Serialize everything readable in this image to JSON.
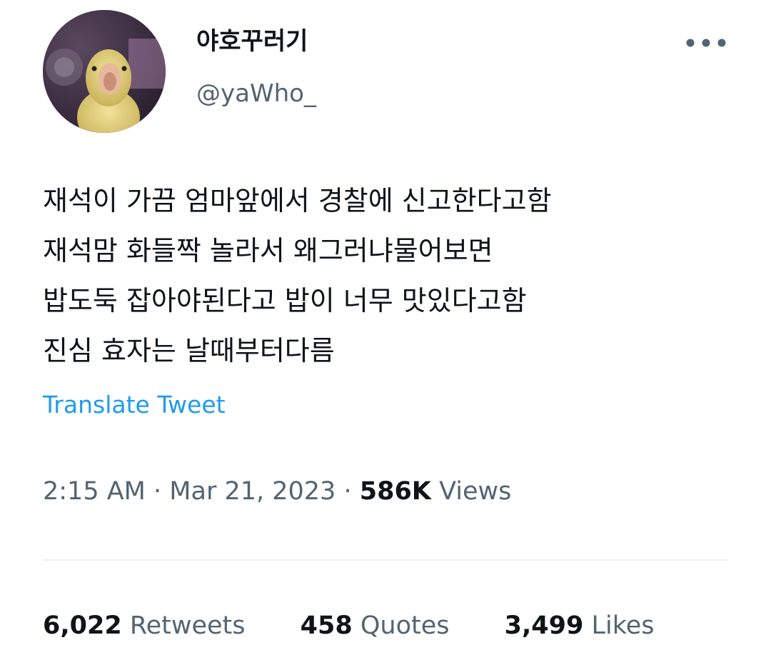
{
  "author": {
    "display_name": "야호꾸러기",
    "handle": "@yaWho_"
  },
  "tweet": {
    "lines": [
      "재석이 가끔 엄마앞에서 경찰에 신고한다고함",
      "재석맘 화들짝 놀라서 왜그러냐물어보면",
      "밥도둑 잡아야된다고 밥이 너무 맛있다고함",
      "진심 효자는 날때부터다름"
    ],
    "translate_label": "Translate Tweet"
  },
  "meta": {
    "time": "2:15 AM",
    "separator": "·",
    "date": "Mar 21, 2023",
    "views_count": "586K",
    "views_label": "Views"
  },
  "stats": {
    "retweets_count": "6,022",
    "retweets_label": "Retweets",
    "quotes_count": "458",
    "quotes_label": "Quotes",
    "likes_count": "3,499",
    "likes_label": "Likes"
  },
  "icons": {
    "more": "more-horizontal-icon",
    "avatar": "duckling-photo"
  },
  "colors": {
    "link": "#1d9bf0",
    "secondary_text": "#536471",
    "primary_text": "#0f1419",
    "divider": "#eff3f4"
  }
}
